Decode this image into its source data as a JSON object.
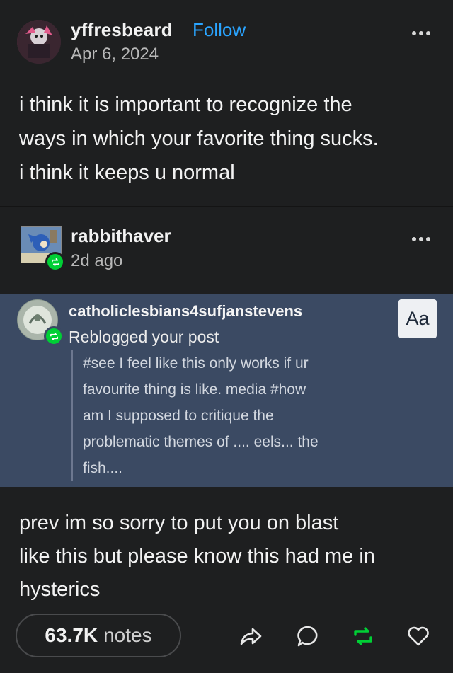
{
  "post": {
    "author": "yffresbeard",
    "follow_label": "Follow",
    "date": "Apr 6, 2024",
    "body_lines": [
      "i think it is important to recognize the",
      "ways in which your favorite thing sucks.",
      "i think it keeps u normal"
    ]
  },
  "reblog": {
    "author": "rabbithaver",
    "time_ago": "2d ago",
    "quoted": {
      "author": "catholiclesbians4sufjanstevens",
      "action": "Reblogged your post",
      "aa_label": "Aa",
      "tag_lines": [
        "#see I feel like this only works if ur",
        "favourite thing is like. media #how",
        "am I supposed to critique the",
        "problematic themes of .... eels... the",
        "fish...."
      ]
    },
    "comment_lines": [
      "prev im so sorry to put you on blast",
      "like this but please know this had me in",
      "hysterics"
    ]
  },
  "footer": {
    "notes_count": "63.7K",
    "notes_label": "notes"
  },
  "colors": {
    "background": "#1e1f20",
    "follow_blue": "#2aa4ff",
    "reblog_green": "#00cf35",
    "quote_block": "#3b4a63"
  },
  "icons": [
    "more-icon",
    "reblog-badge-icon",
    "share-icon",
    "reply-icon",
    "reblog-icon",
    "like-icon"
  ]
}
